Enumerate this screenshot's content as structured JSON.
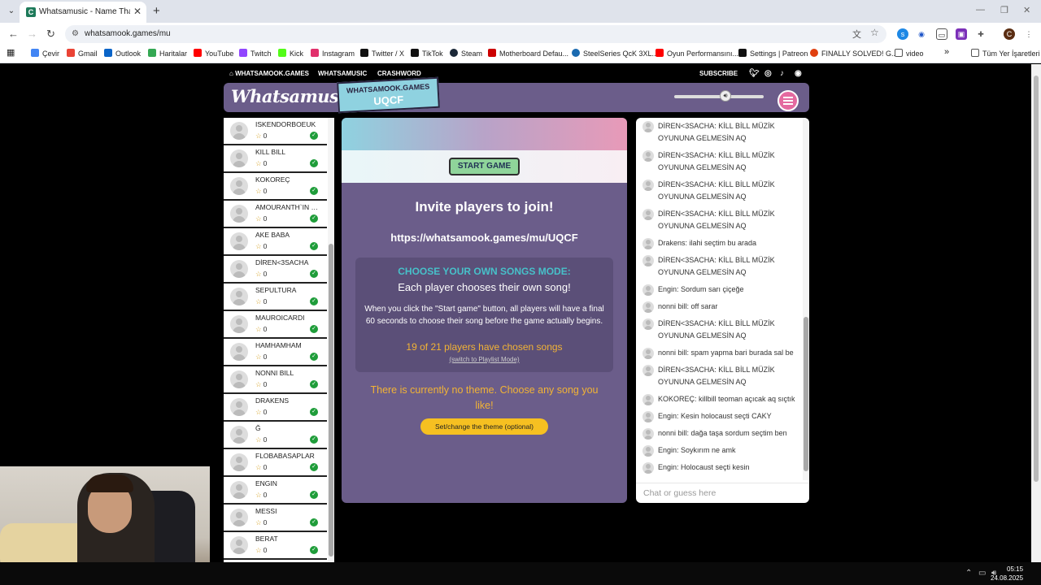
{
  "browser": {
    "tab_title": "Whatsamusic - Name That Tune",
    "url": "whatsamook.games/mu",
    "bookmarks": [
      {
        "label": "Çevir",
        "color": "#4285f4"
      },
      {
        "label": "Gmail",
        "color": "#ea4335"
      },
      {
        "label": "Outlook",
        "color": "#0a64c8"
      },
      {
        "label": "Haritalar",
        "color": "#34a853"
      },
      {
        "label": "YouTube",
        "color": "#ff0000"
      },
      {
        "label": "Twitch",
        "color": "#9146ff"
      },
      {
        "label": "Kick",
        "color": "#53fc18"
      },
      {
        "label": "Instagram",
        "color": "#e1306c"
      },
      {
        "label": "Twitter / X",
        "color": "#111111"
      },
      {
        "label": "TikTok",
        "color": "#111111"
      },
      {
        "label": "Steam",
        "color": "#1b2838"
      },
      {
        "label": "Motherboard Defau...",
        "color": "#cc0000"
      },
      {
        "label": "SteelSeries QcK 3XL...",
        "color": "#1a6ab0"
      },
      {
        "label": "Oyun Performansını...",
        "color": "#ff0000"
      },
      {
        "label": "Settings | Patreon",
        "color": "#111111"
      },
      {
        "label": "FINALLY SOLVED! G...",
        "color": "#e04010"
      },
      {
        "label": "video",
        "color": "#555555"
      }
    ],
    "all_bookmarks": "Tüm Yer İşaretleri"
  },
  "site_nav": {
    "home": "WHATSAMOOK.GAMES",
    "whatsamusic": "WHATSAMUSIC",
    "crashword": "CRASHWORD",
    "subscribe": "SUBSCRIBE"
  },
  "header": {
    "logo": "Whatsamusic",
    "room_site": "WHATSAMOOK.GAMES",
    "room_code": "UQCF"
  },
  "players": [
    {
      "name": "ISKENDORBOEUK",
      "score": "0"
    },
    {
      "name": "KILL BILL",
      "score": "0"
    },
    {
      "name": "KOKOREÇ",
      "score": "0"
    },
    {
      "name": "AMOURANTH`IN DI...",
      "score": "0"
    },
    {
      "name": "AKE BABA",
      "score": "0"
    },
    {
      "name": "DİREN<3SACHA",
      "score": "0"
    },
    {
      "name": "SEPULTURA",
      "score": "0"
    },
    {
      "name": "MAUROICARDI",
      "score": "0"
    },
    {
      "name": "HAMHAMHAM",
      "score": "0"
    },
    {
      "name": "NONNI BILL",
      "score": "0"
    },
    {
      "name": "DRAKENS",
      "score": "0"
    },
    {
      "name": "Ğ",
      "score": "0"
    },
    {
      "name": "FLOBABASAPLAR",
      "score": "0"
    },
    {
      "name": "ENGIN",
      "score": "0"
    },
    {
      "name": "MESSI",
      "score": "0"
    },
    {
      "name": "BERAT",
      "score": "0"
    }
  ],
  "main": {
    "start_button": "START GAME",
    "invite_title": "Invite players to join!",
    "invite_link": "https://whatsamook.games/mu/UQCF",
    "mode_title": "CHOOSE YOUR OWN SONGS MODE:",
    "mode_subtitle": "Each player chooses their own song!",
    "mode_desc": "When you click the \"Start game\" button, all players will have a final 60 seconds to choose their song before the game actually begins.",
    "mode_count": "19 of 21 players have chosen songs",
    "mode_switch": "(switch to Playlist Mode)",
    "theme_text": "There is currently no theme. Choose any song you like!",
    "theme_button": "Set/change the theme (optional)"
  },
  "chat": {
    "messages": [
      "DİREN<3SACHA: KİLL BİLL MÜZİK OYUNUNA GELMESİN AQ",
      "DİREN<3SACHA: KİLL BİLL MÜZİK OYUNUNA GELMESİN AQ",
      "DİREN<3SACHA: KİLL BİLL MÜZİK OYUNUNA GELMESİN AQ",
      "DİREN<3SACHA: KİLL BİLL MÜZİK OYUNUNA GELMESİN AQ",
      "Drakens: ilahi seçtim bu arada",
      "DİREN<3SACHA: KİLL BİLL MÜZİK OYUNUNA GELMESİN AQ",
      "Engin: Sordum sarı çiçeğe",
      "nonni bill: off sarar",
      "DİREN<3SACHA: KİLL BİLL MÜZİK OYUNUNA GELMESİN AQ",
      "nonni bill: spam yapma bari burada sal be",
      "DİREN<3SACHA: KİLL BİLL MÜZİK OYUNUNA GELMESİN AQ",
      "KOKOREÇ: killbill teoman açıcak aq sıçtık",
      "Engin: Kesin holocaust seçti CAKY",
      "nonni bill: dağa taşa sordum seçtim ben",
      "Engin: Soykırım ne amk",
      "Engin: Holocaust seçti kesin"
    ],
    "input_placeholder": "Chat or guess here"
  },
  "taskbar": {
    "time": "05:15",
    "date": "24.08.2025"
  },
  "colors": {
    "panel": "#6b5d8a",
    "accent_teal": "#47c0c9",
    "accent_yellow": "#f2b335",
    "button_green": "#8fd49a"
  }
}
